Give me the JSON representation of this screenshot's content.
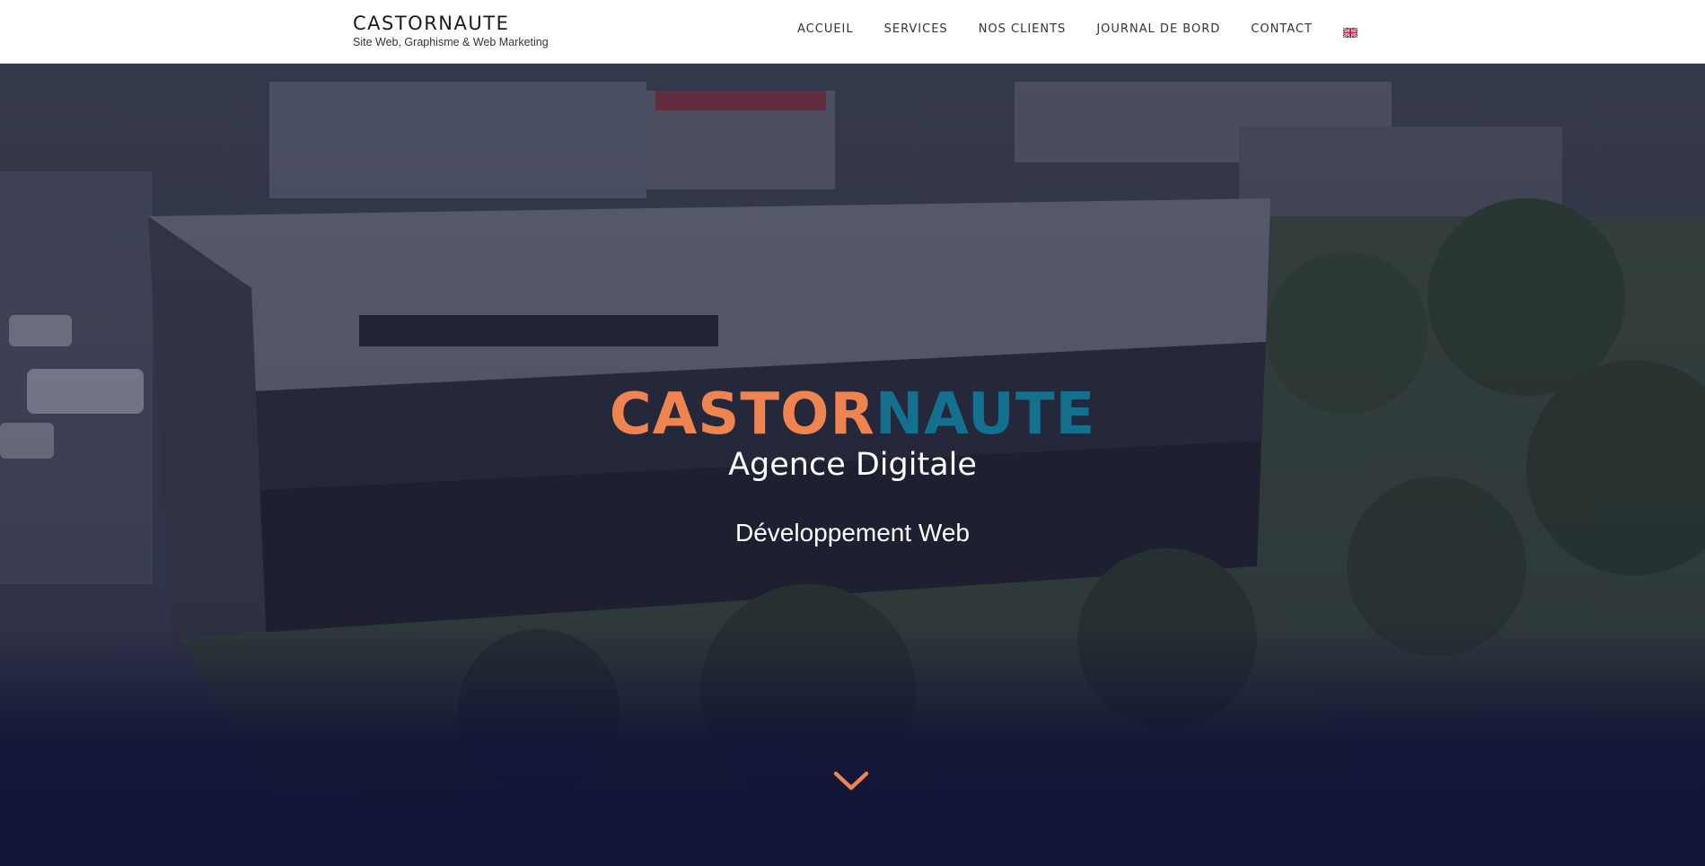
{
  "header": {
    "brand_title": "CASTORNAUTE",
    "brand_tagline": "Site Web, Graphisme & Web Marketing",
    "nav": [
      {
        "label": "ACCUEIL"
      },
      {
        "label": "SERVICES"
      },
      {
        "label": "NOS CLIENTS"
      },
      {
        "label": "JOURNAL DE BORD"
      },
      {
        "label": "CONTACT"
      }
    ],
    "language_flag": "uk-flag-icon"
  },
  "hero": {
    "title_part_a": "CASTOR",
    "title_part_b": "NAUTE",
    "subtitle": "Agence Digitale",
    "rotating_text": "Développement Web",
    "scroll_icon": "chevron-down-icon",
    "background": "aerial-office-building-photo"
  },
  "colors": {
    "accent_orange": "#ef8451",
    "accent_blue": "#13708e",
    "hero_dark": "#121436",
    "header_bg": "#ffffff"
  }
}
